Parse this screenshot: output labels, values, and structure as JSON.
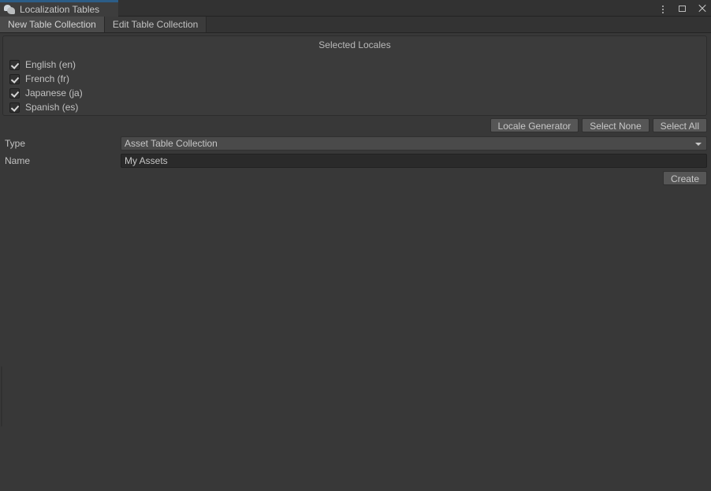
{
  "window": {
    "tab_title": "Localization Tables",
    "icon": "speech-bubbles-icon",
    "controls": {
      "menu": "kebab-menu-icon",
      "maximize": "maximize-icon",
      "close": "close-icon"
    },
    "accent_color": "#2c5d87"
  },
  "toolbar": {
    "tabs": [
      {
        "label": "New Table Collection",
        "selected": true
      },
      {
        "label": "Edit Table Collection",
        "selected": false
      }
    ]
  },
  "locales_panel": {
    "header": "Selected Locales",
    "items": [
      {
        "label": "English (en)",
        "checked": true
      },
      {
        "label": "French (fr)",
        "checked": true
      },
      {
        "label": "Japanese (ja)",
        "checked": true
      },
      {
        "label": "Spanish (es)",
        "checked": true
      }
    ],
    "buttons": [
      {
        "label": "Locale Generator"
      },
      {
        "label": "Select None"
      },
      {
        "label": "Select All"
      }
    ]
  },
  "form": {
    "type": {
      "label": "Type",
      "value": "Asset Table Collection",
      "dropdown_icon": "chevron-down-icon"
    },
    "name": {
      "label": "Name",
      "value": "My Assets",
      "placeholder": ""
    },
    "create_button": "Create"
  }
}
